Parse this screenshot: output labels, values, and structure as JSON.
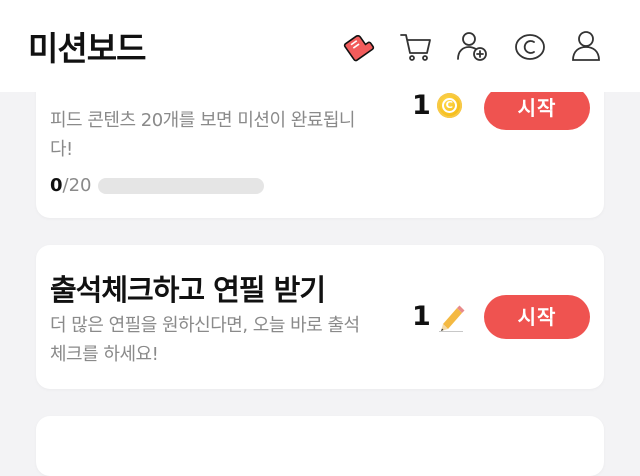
{
  "header": {
    "title": "미션보드",
    "icons": [
      "shoe-icon",
      "cart-icon",
      "add-friend-icon",
      "coin-icon",
      "profile-icon"
    ]
  },
  "missions": [
    {
      "title": "",
      "description": "피드 콘텐츠 20개를 보면 미션이 완료됩니다!",
      "progress_current": "0",
      "progress_total": "/20",
      "progress_fraction": 0,
      "reward_count": "1",
      "reward_icon": "coin-icon",
      "button_label": "시작"
    },
    {
      "title": "출석체크하고 연필 받기",
      "description": "더 많은 연필을 원하신다면, 오늘 바로 출석체크를 하세요!",
      "reward_count": "1",
      "reward_icon": "pencil-icon",
      "button_label": "시작"
    }
  ],
  "colors": {
    "accent": "#ef5350",
    "coin": "#f0b000",
    "pencil": "#f4b942",
    "background": "#f3f3f5"
  }
}
